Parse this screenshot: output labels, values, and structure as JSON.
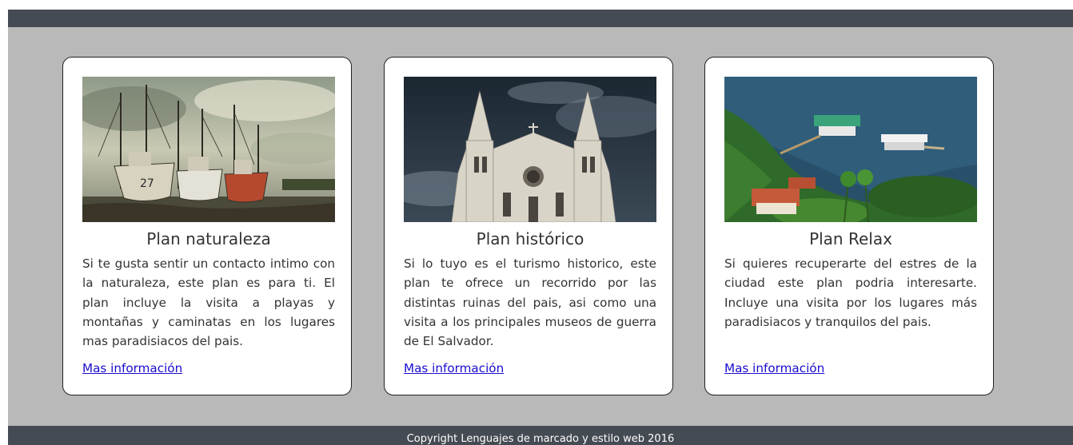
{
  "cards": [
    {
      "title": "Plan naturaleza",
      "text": "Si te gusta sentir un contacto intimo con la naturaleza, este plan es para ti. El plan incluye la visita a playas y montañas y caminatas en los lugares mas paradisiacos del pais.",
      "link": "Mas información",
      "image": "shrimp-boats-photo"
    },
    {
      "title": "Plan histórico",
      "text": "Si lo tuyo es el turismo historico, este plan te ofrece un recorrido por las distintas ruinas del pais, asi como una visita a los principales museos de guerra de El Salvador.",
      "link": "Mas información",
      "image": "cathedral-photo"
    },
    {
      "title": "Plan Relax",
      "text": "Si quieres recuperarte del estres de la ciudad este plan podria interesarte. Incluye una visita por los lugares más paradisiacos y tranquilos del pais.",
      "link": "Mas información",
      "image": "lake-resort-photo"
    }
  ],
  "footer": {
    "copyright": "Copyright Lenguajes de marcado y estilo web 2016"
  },
  "colors": {
    "header_bar": "#454b52",
    "page_background": "#b9b9b9",
    "card_background": "#ffffff",
    "link": "#1a0dcc"
  }
}
